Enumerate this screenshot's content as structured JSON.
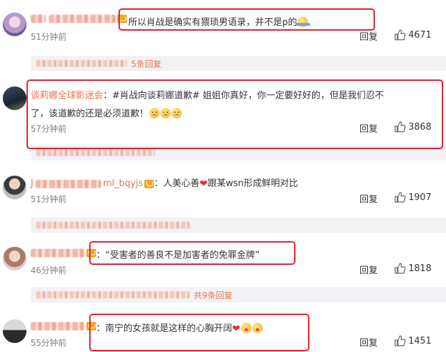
{
  "comments": [
    {
      "text": "所以肖战是确实有猥琐男语录，并不是p的",
      "time": "51分钟前",
      "reply": "回复",
      "likes": "4671",
      "sub": "5条回复"
    },
    {
      "name": "谈莉娜全球影迷会",
      "text_line1": "：#肖战向谈莉娜道歉# 姐姐你真好，你一定要好好的，但是我们忍不",
      "text_line2": "了，该道歉的还是必须道歉！",
      "time": "57分钟前",
      "reply": "回复",
      "likes": "3868"
    },
    {
      "name": "J",
      "name_tail": "ml_bqyjs",
      "text": "：人美心善",
      "text_tail": "跟某wsn形成鲜明对比",
      "time": "51分钟前",
      "reply": "回复",
      "likes": "1907"
    },
    {
      "text": "：“受害者的善良不是加害者的免罪金牌”",
      "time": "46分钟前",
      "reply": "回复",
      "likes": "1818",
      "sub": "共9条回复"
    },
    {
      "text": "：南宁的女孩就是这样的心胸开阔",
      "time": "55分钟前",
      "reply": "回复",
      "likes": "1451"
    }
  ],
  "colors": {
    "highlight": "#e0202f",
    "name": "#eb7350",
    "meta": "#808080"
  },
  "icons": [
    "thumbs-up-icon",
    "vip-icon",
    "heart-icon",
    "sad-emoji-icon",
    "kiss-emoji-icon"
  ]
}
